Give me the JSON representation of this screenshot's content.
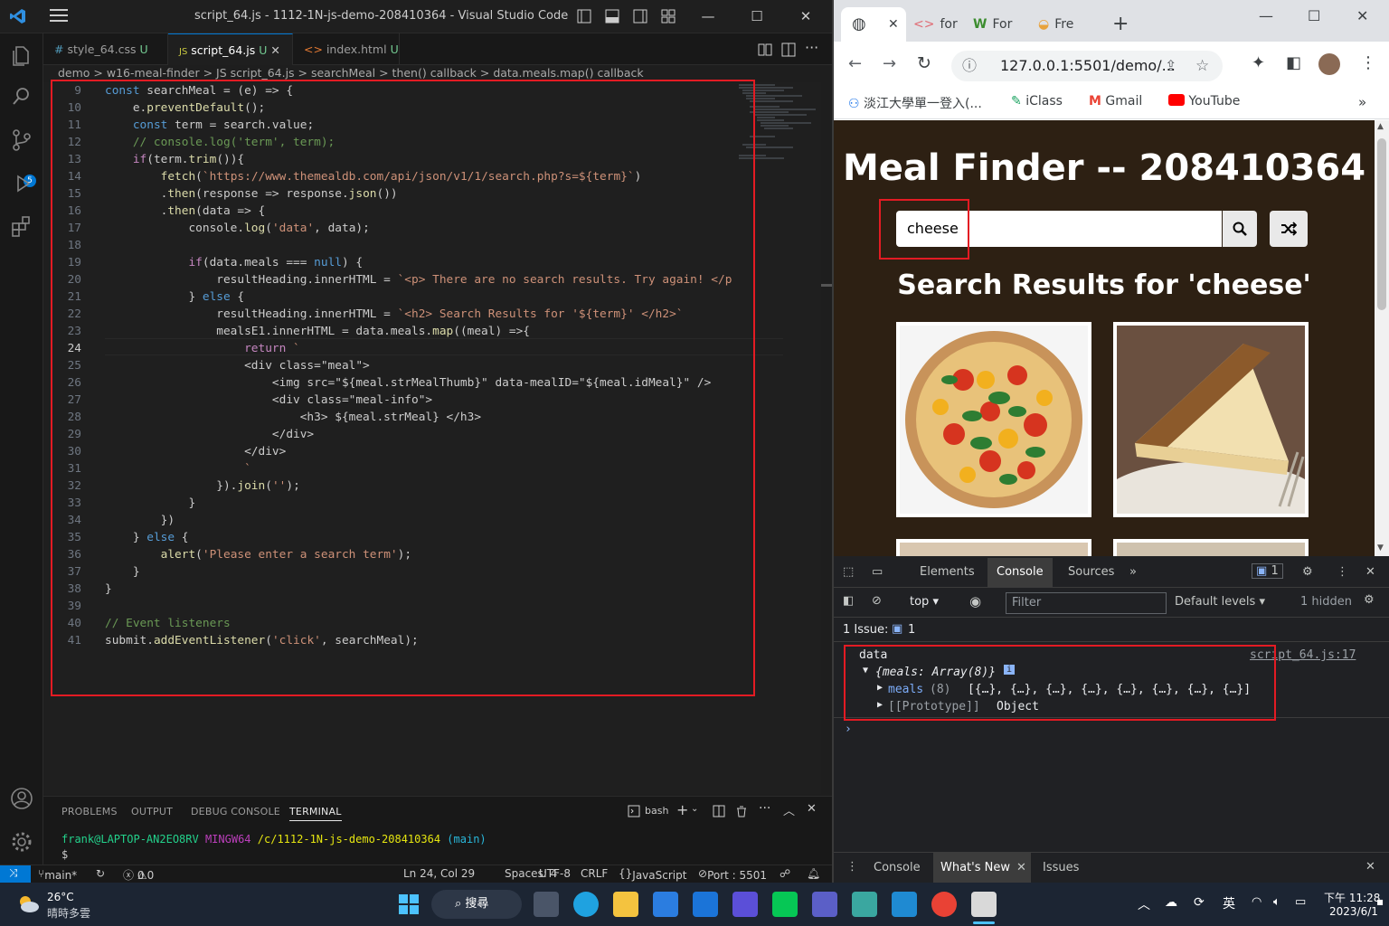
{
  "vscode": {
    "window_title": "script_64.js - 1112-1N-js-demo-208410364 - Visual Studio Code",
    "tabs": [
      {
        "icon": "#",
        "label": "style_64.css",
        "status": "U"
      },
      {
        "icon": "JS",
        "label": "script_64.js",
        "status": "U"
      },
      {
        "icon": "<>",
        "label": "index.html",
        "status": "U"
      }
    ],
    "breadcrumb": [
      "demo",
      "w16-meal-finder",
      "JS script_64.js",
      "searchMeal",
      "then() callback",
      "data.meals.map() callback"
    ],
    "activity_badge": "5",
    "line_numbers": [
      "9",
      "10",
      "11",
      "12",
      "13",
      "14",
      "15",
      "16",
      "17",
      "18",
      "19",
      "20",
      "21",
      "22",
      "23",
      "24",
      "25",
      "26",
      "27",
      "28",
      "29",
      "30",
      "31",
      "32",
      "33",
      "34",
      "35",
      "36",
      "37",
      "38",
      "39",
      "40",
      "41"
    ],
    "code_lines": [
      "const searchMeal = (e) => {",
      "    e.preventDefault();",
      "    const term = search.value;",
      "    // console.log('term', term);",
      "    if(term.trim()){",
      "        fetch(`https://www.themealdb.com/api/json/v1/1/search.php?s=${term}`)",
      "        .then(response => response.json())",
      "        .then(data => {",
      "            console.log('data', data);",
      "",
      "            if(data.meals === null) {",
      "                resultHeading.innerHTML = `<p> There are no search results. Try again! </p",
      "            } else {",
      "                resultHeading.innerHTML = `<h2> Search Results for '${term}' </h2>`",
      "                mealsE1.innerHTML = data.meals.map((meal) =>{",
      "                    return `",
      "                    <div class=\"meal\">",
      "                        <img src=\"${meal.strMealThumb}\" data-mealID=\"${meal.idMeal}\" />",
      "                        <div class=\"meal-info\">",
      "                            <h3> ${meal.strMeal} </h3>",
      "                        </div>",
      "                    </div>",
      "                    `",
      "                }).join('');",
      "            }",
      "        })",
      "    } else {",
      "        alert('Please enter a search term');",
      "    }",
      "}",
      "",
      "// Event listeners",
      "submit.addEventListener('click', searchMeal);"
    ],
    "panel_tabs": [
      "PROBLEMS",
      "OUTPUT",
      "DEBUG CONSOLE",
      "TERMINAL"
    ],
    "terminal_shell": "bash",
    "terminal_user": "frank@LAPTOP-AN2EO8RV",
    "terminal_env": "MINGW64",
    "terminal_path": "/c/1112-1N-js-demo-208410364",
    "terminal_branch": "(main)",
    "terminal_prompt": "$",
    "status": {
      "branch": "main*",
      "errors": "0",
      "warnings": "0",
      "cursor": "Ln 24, Col 29",
      "spaces": "Spaces: 4",
      "encoding": "UTF-8",
      "eol": "CRLF",
      "language": "JavaScript",
      "port": "Port : 5501"
    }
  },
  "chrome": {
    "tabs": [
      "for",
      "For",
      "Fre"
    ],
    "url": "127.0.0.1:5501/demo/...",
    "bookmarks": [
      "淡江大學單一登入(...",
      "iClass",
      "Gmail",
      "YouTube"
    ],
    "bookmarks_more": "»",
    "page": {
      "title": "Meal Finder -- 208410364",
      "search_value": "cheese",
      "results_heading": "Search Results for 'cheese'"
    },
    "devtools": {
      "tabs": [
        "Elements",
        "Console",
        "Sources"
      ],
      "issues_count": "1",
      "context": "top",
      "filter_placeholder": "Filter",
      "levels": "Default levels",
      "hidden": "1 hidden",
      "issue_bar": "1 Issue:",
      "issue_bar_count": "1",
      "log_label": "data",
      "log_source": "script_64.js:17",
      "obj_summary": "{meals: Array(8)}",
      "meals_key": "meals",
      "meals_count": "(8)",
      "meals_value": "[{…}, {…}, {…}, {…}, {…}, {…}, {…}, {…}]",
      "proto_key": "[[Prototype]]",
      "proto_value": "Object",
      "drawer_tabs": [
        "Console",
        "What's New",
        "Issues"
      ]
    }
  },
  "taskbar": {
    "weather_temp": "26°C",
    "weather_desc": "晴時多雲",
    "search_label": "搜尋",
    "ime": "英",
    "time": "下午 11:28",
    "date": "2023/6/1"
  }
}
